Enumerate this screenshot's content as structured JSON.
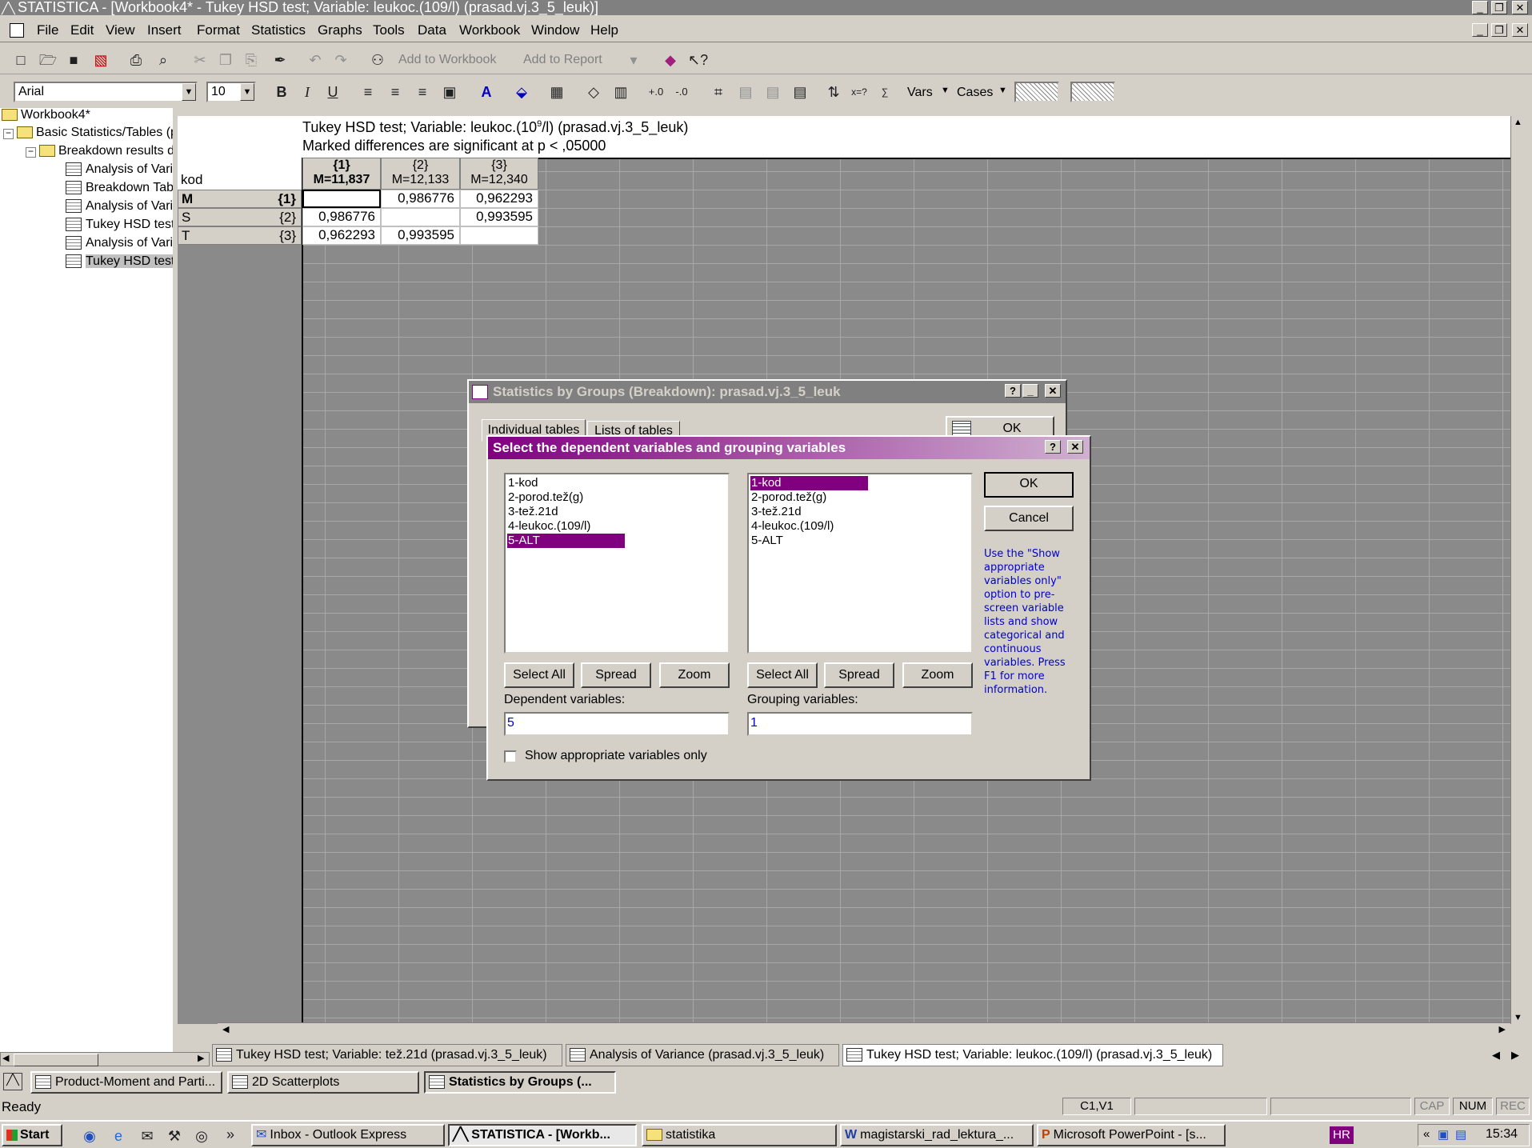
{
  "window": {
    "title": "STATISTICA - [Workbook4* - Tukey HSD test; Variable: leukoc.(109/l) (prasad.vj.3_5_leuk)]"
  },
  "menu": [
    "File",
    "Edit",
    "View",
    "Insert",
    "Format",
    "Statistics",
    "Graphs",
    "Tools",
    "Data",
    "Workbook",
    "Window",
    "Help"
  ],
  "toolbar": {
    "add_to_workbook": "Add to Workbook",
    "add_to_report": "Add to Report",
    "font_name": "Arial",
    "font_size": "10",
    "vars": "Vars",
    "cases": "Cases"
  },
  "tree": {
    "root": "Workbook4*",
    "group": "Basic Statistics/Tables (prasa",
    "subgroup": "Breakdown results dialog",
    "items": [
      "Analysis of Variance",
      "Breakdown Table of",
      "Analysis of Variance",
      "Tukey HSD test; Vari",
      "Analysis of Variance",
      "Tukey HSD test; Vari"
    ]
  },
  "spreadsheet": {
    "title_line1_pre": "Tukey HSD test; Variable: leukoc.(10",
    "title_sup": "9",
    "title_line1_post": "/l) (prasad.vj.3_5_leuk)",
    "title_line2": "Marked differences are significant at p < ,05000",
    "row_header_label": "kod",
    "columns": [
      {
        "id": "{1}",
        "mean": "M=11,837"
      },
      {
        "id": "{2}",
        "mean": "M=12,133"
      },
      {
        "id": "{3}",
        "mean": "M=12,340"
      }
    ],
    "rows": [
      {
        "label": "M",
        "id": "{1}",
        "cells": [
          "",
          "0,986776",
          "0,962293"
        ]
      },
      {
        "label": "S",
        "id": "{2}",
        "cells": [
          "0,986776",
          "",
          "0,993595"
        ]
      },
      {
        "label": "T",
        "id": "{3}",
        "cells": [
          "0,962293",
          "0,993595",
          ""
        ]
      }
    ]
  },
  "breakdown_dialog": {
    "title": "Statistics by Groups (Breakdown): prasad.vj.3_5_leuk",
    "tab1": "Individual tables",
    "tab2": "Lists of tables",
    "ok": "OK"
  },
  "select_dialog": {
    "title": "Select the dependent variables and grouping variables",
    "left_list": [
      "1-kod",
      "2-porod.tež(g)",
      "3-tež.21d",
      "4-leukoc.(109/l)",
      "5-ALT"
    ],
    "right_list": [
      "1-kod",
      "2-porod.tež(g)",
      "3-tež.21d",
      "4-leukoc.(109/l)",
      "5-ALT"
    ],
    "select_all": "Select All",
    "spread": "Spread",
    "zoom": "Zoom",
    "dependent_label": "Dependent variables:",
    "dependent_value": "5",
    "grouping_label": "Grouping variables:",
    "grouping_value": "1",
    "ok": "OK",
    "cancel": "Cancel",
    "help_text": "Use the \"Show appropriate variables only\" option to pre-screen variable lists and show categorical and continuous variables. Press F1 for more information.",
    "checkbox_label": "Show appropriate variables only"
  },
  "sheet_tabs": [
    "Tukey HSD test; Variable: tež.21d (prasad.vj.3_5_leuk)",
    "Analysis of Variance (prasad.vj.3_5_leuk)",
    "Tukey HSD test; Variable: leukoc.(109/l) (prasad.vj.3_5_leuk)"
  ],
  "minimized_windows": [
    "Product-Moment and Parti...",
    "2D Scatterplots",
    "Statistics by Groups (..."
  ],
  "status": {
    "text": "Ready",
    "cell": "C1,V1",
    "cap": "CAP",
    "num": "NUM",
    "rec": "REC"
  },
  "taskbar": {
    "start": "Start",
    "items": [
      "Inbox - Outlook Express",
      "STATISTICA - [Workb...",
      "statistika",
      "magistarski_rad_lektura_...",
      "Microsoft PowerPoint - [s..."
    ],
    "lang": "HR",
    "clock": "15:34"
  },
  "colors": {
    "selection": "#800080",
    "dialog_title": "#800080",
    "help_text": "#0000cc"
  }
}
